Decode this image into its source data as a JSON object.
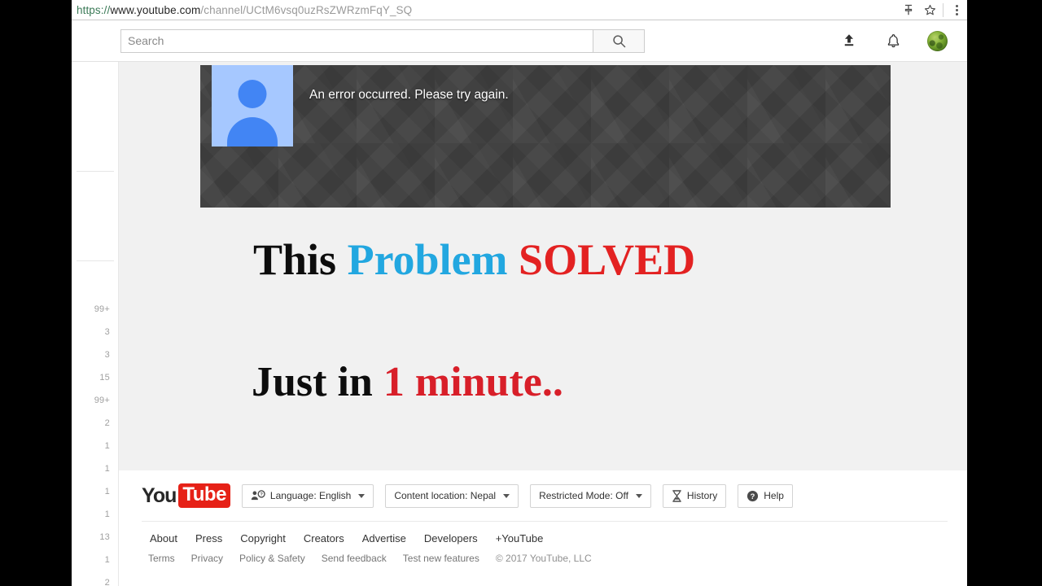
{
  "browser": {
    "url_scheme": "https://www.youtube.com",
    "url_host": "https://www.youtube.com",
    "url_full": "https://www.youtube.com/channel/UCtM6vsq0uzRsZWRzmFqY_SQ",
    "url_path": "/channel/UCtM6vsq0uzRsZWRzmFqY_SQ",
    "icons": {
      "pin": "pin-icon",
      "bookmark": "star-icon",
      "menu": "three-dot-menu-icon"
    }
  },
  "masthead": {
    "search_placeholder": "Search",
    "search_value": "",
    "search_button": "search-icon",
    "upload_icon": "upload-icon",
    "notifications_icon": "bell-icon",
    "avatar": "account-avatar"
  },
  "sidebar": {
    "counts": [
      "99+",
      "3",
      "3",
      "15",
      "99+",
      "2",
      "1",
      "1",
      "1",
      "1",
      "13",
      "1",
      "2"
    ]
  },
  "banner": {
    "error_message": "An error occurred. Please try again.",
    "avatar_placeholder": "default-channel-avatar"
  },
  "overlay": {
    "line1": [
      {
        "text": "This",
        "color": "#0d0d0d"
      },
      {
        "text": "Problem",
        "color": "#22a7e0"
      },
      {
        "text": "SOLVED",
        "color": "#e32222"
      }
    ],
    "line2": [
      {
        "text": "Just in",
        "color": "#0d0d0d"
      },
      {
        "text": "1 minute..",
        "color": "#d81f29"
      }
    ],
    "line1_words": {
      "w1": "This",
      "w2": "Problem",
      "w3": "SOLVED"
    },
    "line2_words": {
      "w1": "Just in",
      "w2": "1 minute.."
    }
  },
  "footer": {
    "logo_you": "You",
    "logo_tube": "Tube",
    "language_button": "Language: English",
    "content_location_button": "Content location: Nepal",
    "restricted_mode_button": "Restricted Mode: Off",
    "history_button": "History",
    "help_button": "Help",
    "links_primary": [
      "About",
      "Press",
      "Copyright",
      "Creators",
      "Advertise",
      "Developers",
      "+YouTube"
    ],
    "links_secondary": [
      "Terms",
      "Privacy",
      "Policy & Safety",
      "Send feedback",
      "Test new features"
    ],
    "copyright": "© 2017 YouTube, LLC"
  }
}
